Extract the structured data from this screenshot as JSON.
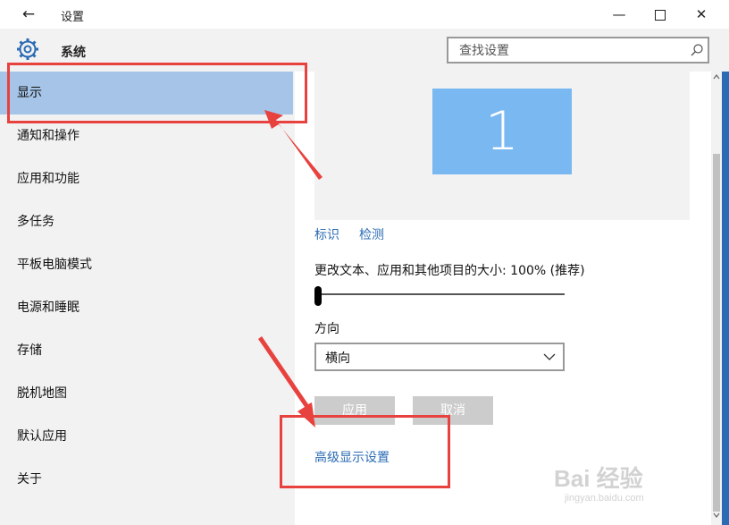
{
  "window": {
    "title": "设置",
    "back_icon": "←",
    "minimize_icon": "—",
    "close_icon": "✕"
  },
  "header": {
    "title": "系统",
    "search_placeholder": "查找设置"
  },
  "sidebar": {
    "items": [
      {
        "label": "显示",
        "active": true
      },
      {
        "label": "通知和操作"
      },
      {
        "label": "应用和功能"
      },
      {
        "label": "多任务"
      },
      {
        "label": "平板电脑模式"
      },
      {
        "label": "电源和睡眠"
      },
      {
        "label": "存储"
      },
      {
        "label": "脱机地图"
      },
      {
        "label": "默认应用"
      },
      {
        "label": "关于"
      }
    ]
  },
  "display": {
    "monitor_number": "1",
    "identify_link": "标识",
    "detect_link": "检测",
    "scale_label": "更改文本、应用和其他项目的大小: 100% (推荐)",
    "scale_level": 0,
    "orientation_label": "方向",
    "orientation_value": "横向",
    "apply_button": "应用",
    "cancel_button": "取消",
    "advanced_link": "高级显示设置"
  },
  "watermark": {
    "logo_text": "Bai 经验",
    "sub_text": "jingyan.baidu.com"
  },
  "colors": {
    "active_item": "#a5c4e7",
    "monitor_tile": "#79b8f1",
    "link": "#2b6cb4",
    "annotation": "#e8423f",
    "window_border": "#2b6ab5"
  }
}
